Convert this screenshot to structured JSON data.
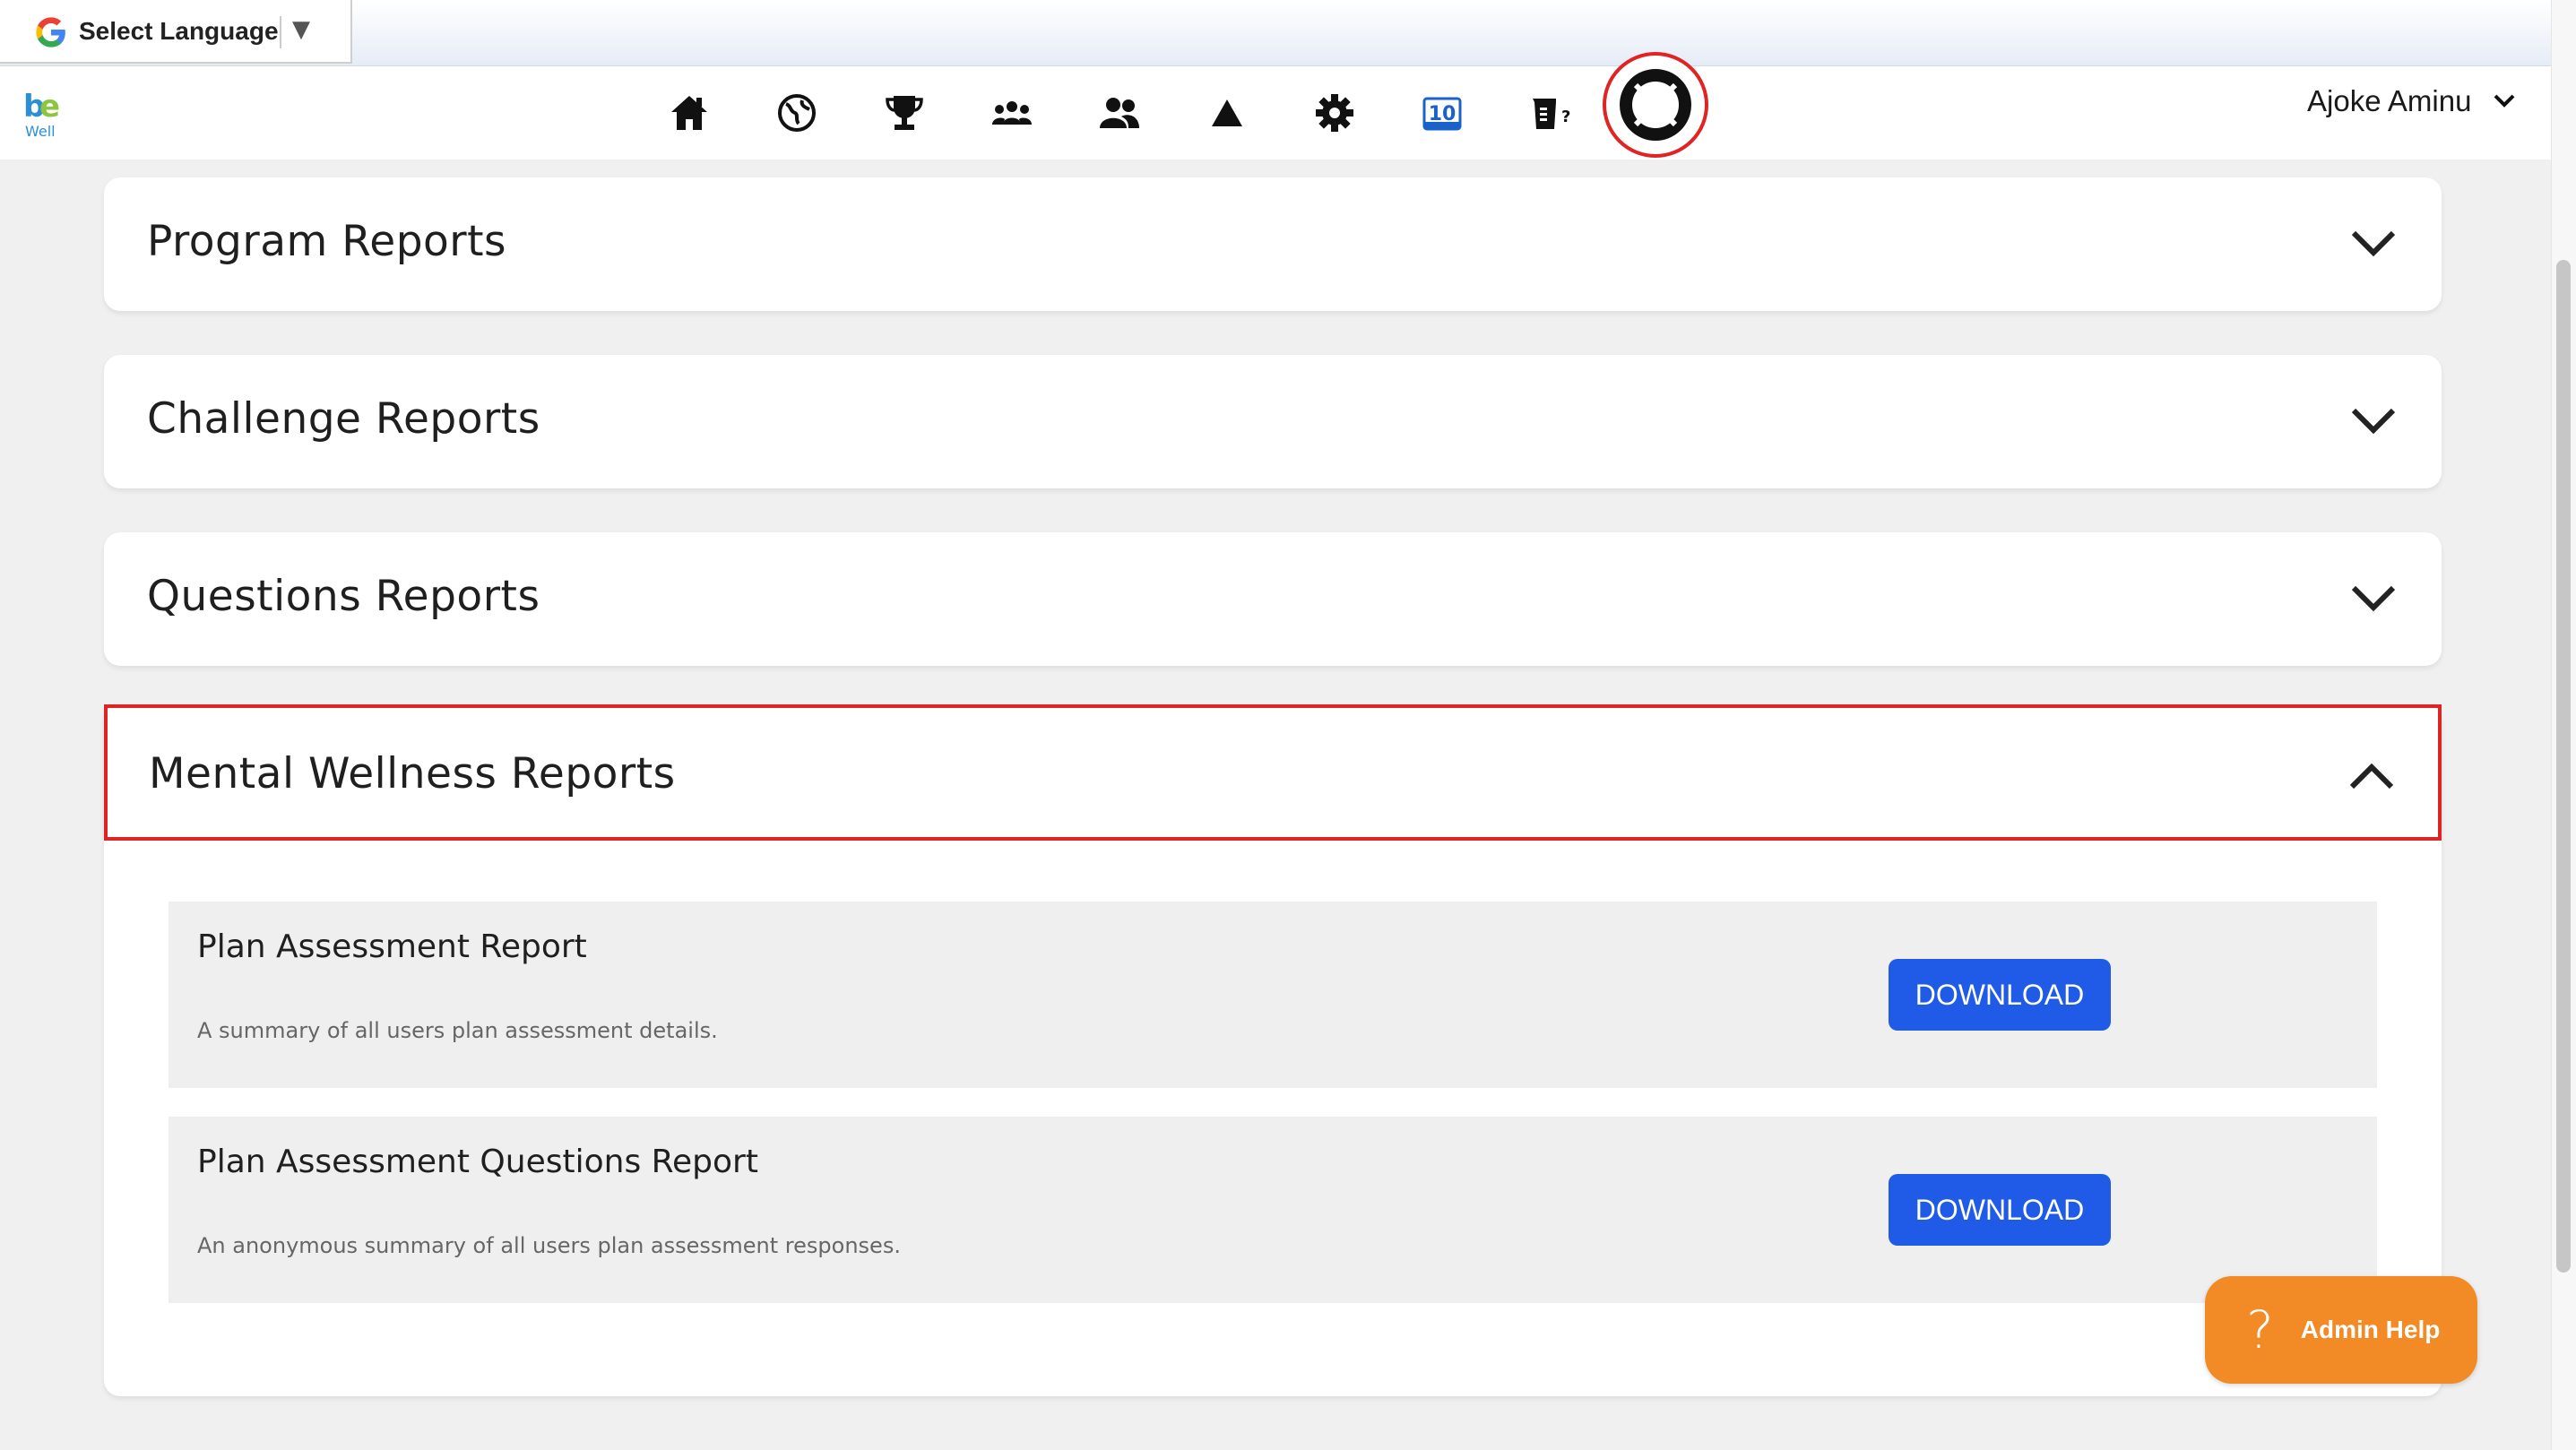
{
  "translate_bar": {
    "label": "Select Language",
    "arrow": "▼",
    "icon": "google-g-icon"
  },
  "nav": {
    "logo_text": "Well",
    "icons": [
      "home-icon",
      "globe-icon",
      "trophy-icon",
      "group-icon",
      "users-icon",
      "triangle-icon",
      "gear-icon",
      "calendar-10-icon",
      "quiz-icon",
      "lifebuoy-icon"
    ],
    "calendar_number": "10",
    "quiz_mark": "?",
    "user_name": "Ajoke Aminu"
  },
  "sections": {
    "program": "Program Reports",
    "challenge": "Challenge Reports",
    "questions": "Questions Reports",
    "mental_wellness": "Mental Wellness Reports"
  },
  "reports": [
    {
      "title": "Plan Assessment Report",
      "description": "A summary of all users plan assessment details.",
      "button": "DOWNLOAD"
    },
    {
      "title": "Plan Assessment Questions Report",
      "description": "An anonymous summary of all users plan assessment responses.",
      "button": "DOWNLOAD"
    }
  ],
  "admin_help": {
    "icon": "?",
    "label": "Admin Help"
  },
  "colors": {
    "primary_button": "#1f5be6",
    "highlight": "#e02424",
    "admin_help": "#f28b26",
    "logo_blue": "#2b8fd8",
    "logo_green": "#8cc63f"
  }
}
